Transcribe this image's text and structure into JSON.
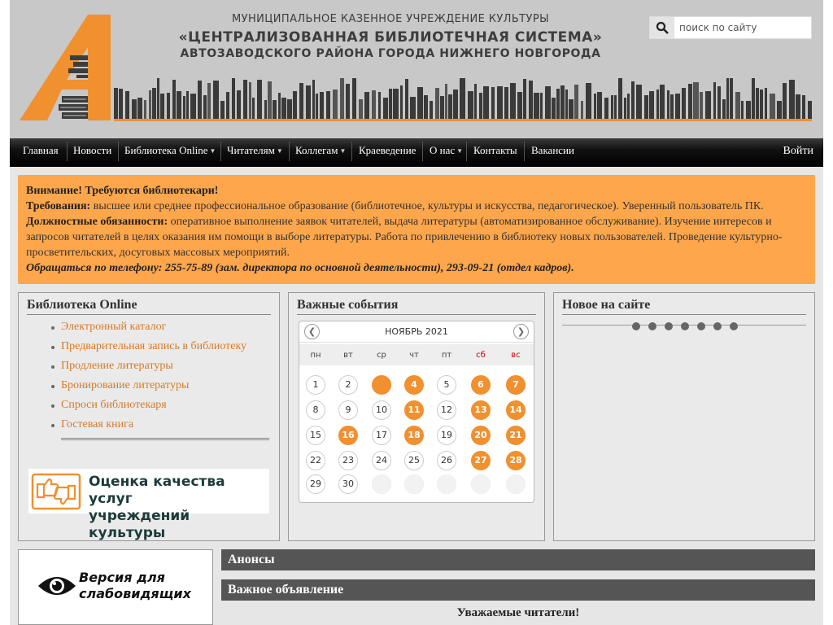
{
  "header": {
    "line1": "МУНИЦИПАЛЬНОЕ КАЗЕННОЕ УЧРЕЖДЕНИЕ КУЛЬТУРЫ",
    "line2": "«ЦЕНТРАЛИЗОВАННАЯ БИБЛИОТЕЧНАЯ СИСТЕМА»",
    "line3": "АВТОЗАВОДСКОГО РАЙОНА ГОРОДА НИЖНЕГО НОВГОРОДА",
    "logo_letter": "А",
    "accent_color": "#f0902f",
    "search": {
      "placeholder": "поиск по сайту",
      "icon": "search-icon"
    }
  },
  "nav": {
    "items": [
      {
        "label": "Главная",
        "dropdown": false
      },
      {
        "label": "Новости",
        "dropdown": false
      },
      {
        "label": "Библиотека Online",
        "dropdown": true
      },
      {
        "label": "Читателям",
        "dropdown": true
      },
      {
        "label": "Коллегам",
        "dropdown": true
      },
      {
        "label": "Краеведение",
        "dropdown": false
      },
      {
        "label": "О нас",
        "dropdown": true
      },
      {
        "label": "Контакты",
        "dropdown": false
      },
      {
        "label": "Вакансии",
        "dropdown": false
      }
    ],
    "login": "Войти"
  },
  "alert": {
    "title": "Внимание! Требуются библиотекари!",
    "req_label": "Требования:",
    "req_text": " высшее или среднее профессиональное образование (библиотечное, культуры и искусства, педагогическое). Уверенный пользователь ПК.",
    "duties_label": "Должностные обязанности:",
    "duties_text": " оперативное выполнение заявок читателей, выдача литературы (автоматизированное обслуживание). Изучение интересов и запросов читателей в целях оказания им помощи в выборе литературы. Работа по привлечению в библиотеку новых пользователей. Проведение культурно-просветительских, досуговых массовых мероприятий.",
    "contact": "Обращаться по телефону: 255-75-89 (зам. директора по основной деятельности), 293-09-21 (отдел кадров)."
  },
  "library_online": {
    "title": "Библиотека Online",
    "links": [
      "Электронный каталог",
      "Предварительная запись в библиотеку",
      "Продление литературы",
      "Бронирование литературы",
      "Спроси библиотекаря",
      "Гостевая книга"
    ],
    "banner_line1": "Оценка качества услуг",
    "banner_line2": "учреждений культуры"
  },
  "events": {
    "title": "Важные события",
    "month": "НОЯБРЬ 2021",
    "prev_icon": "chevron-left-icon",
    "next_icon": "chevron-right-icon",
    "weekdays": [
      "пн",
      "вт",
      "ср",
      "чт",
      "пт",
      "сб",
      "вс"
    ],
    "weeks": [
      [
        {
          "d": "1"
        },
        {
          "d": "2"
        },
        {
          "d": "",
          "ev": true
        },
        {
          "d": "4",
          "ev": true
        },
        {
          "d": "5"
        },
        {
          "d": "6",
          "ev": true
        },
        {
          "d": "7",
          "ev": true
        }
      ],
      [
        {
          "d": "8"
        },
        {
          "d": "9"
        },
        {
          "d": "10"
        },
        {
          "d": "11",
          "ev": true
        },
        {
          "d": "12"
        },
        {
          "d": "13",
          "ev": true
        },
        {
          "d": "14",
          "ev": true
        }
      ],
      [
        {
          "d": "15"
        },
        {
          "d": "16",
          "ev": true
        },
        {
          "d": "17"
        },
        {
          "d": "18",
          "ev": true
        },
        {
          "d": "19"
        },
        {
          "d": "20",
          "ev": true
        },
        {
          "d": "21",
          "ev": true
        }
      ],
      [
        {
          "d": "22"
        },
        {
          "d": "23"
        },
        {
          "d": "24"
        },
        {
          "d": "25"
        },
        {
          "d": "26"
        },
        {
          "d": "27",
          "ev": true
        },
        {
          "d": "28",
          "ev": true
        }
      ],
      [
        {
          "d": "29"
        },
        {
          "d": "30"
        },
        {
          "d": "",
          "empty": true
        },
        {
          "d": "",
          "empty": true
        },
        {
          "d": "",
          "empty": true
        },
        {
          "d": "",
          "empty": true
        },
        {
          "d": "",
          "empty": true
        }
      ]
    ]
  },
  "new_on_site": {
    "title": "Новое на сайте",
    "dot_count": 7
  },
  "low_vision": {
    "line1": "Версия для",
    "line2": "слабовидящих",
    "icon": "eye-icon"
  },
  "announcements": {
    "title": "Анонсы"
  },
  "important": {
    "title": "Важное объявление",
    "text": "Уважаемые читатели!"
  }
}
